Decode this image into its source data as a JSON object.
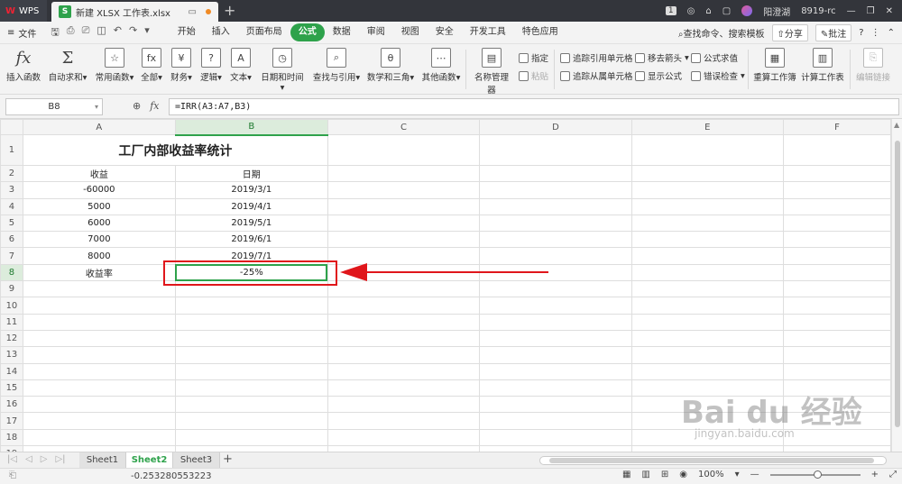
{
  "titlebar": {
    "app_label": "WPS",
    "file_tab": "新建 XLSX 工作表.xlsx",
    "badge": "1",
    "user_name": "阳澄湖",
    "user_id": "8919-rc"
  },
  "menubar": {
    "file_label": "文件",
    "tabs": [
      "开始",
      "插入",
      "页面布局",
      "公式",
      "数据",
      "审阅",
      "视图",
      "安全",
      "开发工具",
      "特色应用"
    ],
    "active_tab": "公式",
    "search_label": "查找命令、搜索模板",
    "share_label": "分享",
    "comment_label": "批注"
  },
  "ribbon": {
    "insert_func": "插入函数",
    "autosum": "自动求和",
    "common_func": "常用函数",
    "all": "全部",
    "finance": "财务",
    "logic": "逻辑",
    "text": "文本",
    "datetime": "日期和时间",
    "lookup": "查找与引用",
    "math": "数学和三角",
    "other_func": "其他函数",
    "name_manager": "名称管理器",
    "specify": "指定",
    "paste": "粘贴",
    "trace_precedents": "追踪引用单元格",
    "trace_dependents": "追踪从属单元格",
    "remove_arrows": "移去箭头",
    "show_formula": "显示公式",
    "eval_formula": "公式求值",
    "error_check": "错误检查",
    "recalc_workbook": "重算工作簿",
    "calc_sheet": "计算工作表",
    "edit_links": "编辑链接"
  },
  "formulabar": {
    "cell_ref": "B8",
    "formula": "=IRR(A3:A7,B3)"
  },
  "sheet": {
    "columns": [
      "A",
      "B",
      "C",
      "D",
      "E",
      "F"
    ],
    "selected_column": "B",
    "selected_row": "8",
    "title": "工厂内部收益率统计",
    "header_income": "收益",
    "header_date": "日期",
    "rows": [
      {
        "num": "3",
        "income": "-60000",
        "date": "2019/3/1"
      },
      {
        "num": "4",
        "income": "5000",
        "date": "2019/4/1"
      },
      {
        "num": "5",
        "income": "6000",
        "date": "2019/5/1"
      },
      {
        "num": "6",
        "income": "7000",
        "date": "2019/6/1"
      },
      {
        "num": "7",
        "income": "8000",
        "date": "2019/7/1"
      }
    ],
    "rate_label": "收益率",
    "rate_value": "-25%"
  },
  "sheettabs": [
    "Sheet1",
    "Sheet2",
    "Sheet3"
  ],
  "active_sheet": "Sheet2",
  "statusbar": {
    "value": "-0.253280553223",
    "zoom": "100%"
  },
  "watermark": {
    "brand": "Bai du 经验",
    "url": "jingyan.baidu.com"
  },
  "colors": {
    "accent": "#2ea24b",
    "annotation_red": "#e0161b"
  }
}
